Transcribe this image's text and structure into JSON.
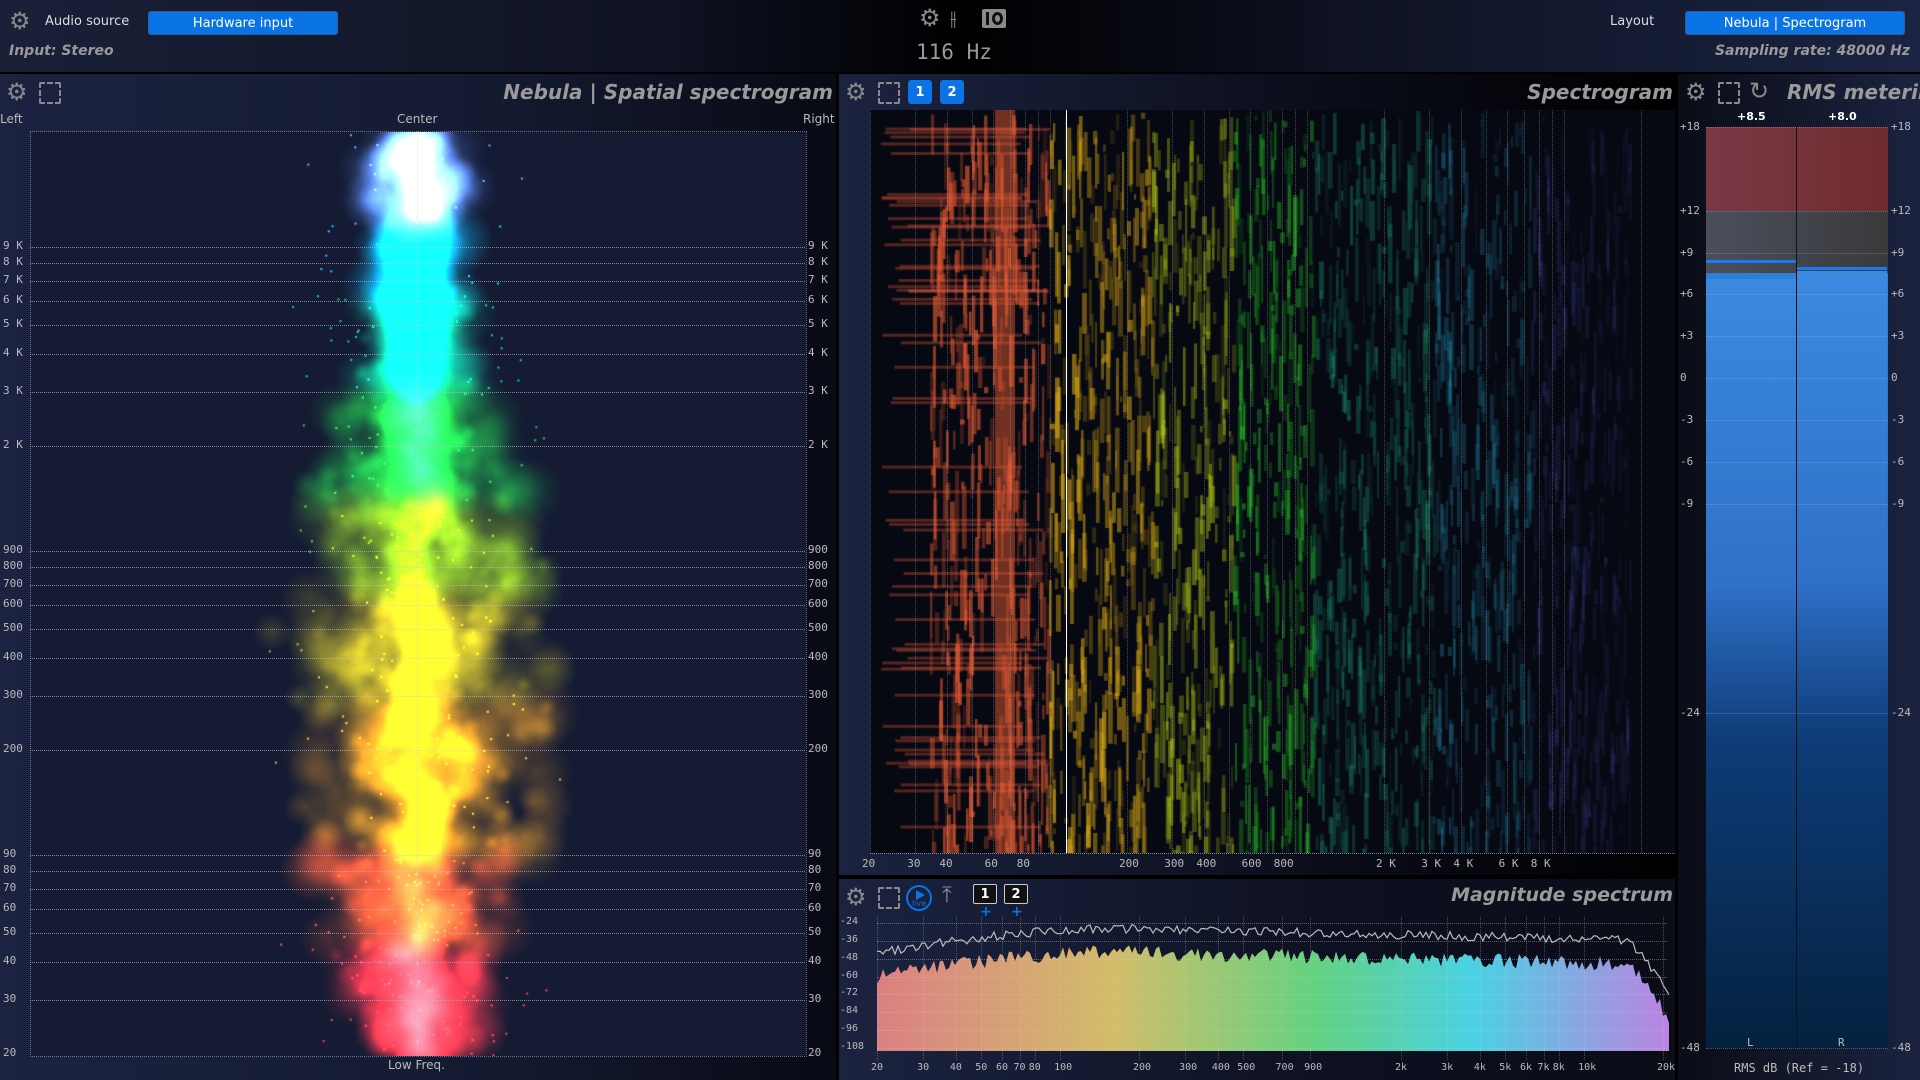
{
  "topbar": {
    "audio_source_label": "Audio source",
    "audio_source_value": "Hardware input",
    "input_status": "Input: Stereo",
    "frequency_readout": "116 Hz",
    "layout_label": "Layout",
    "layout_value": "Nebula | Spectrogram",
    "sampling_rate": "Sampling rate: 48000 Hz"
  },
  "spatial": {
    "title": "Nebula | Spatial spectrogram",
    "left_label": "Left",
    "center_label": "Center",
    "right_label": "Right",
    "bottom_label": "Low Freq.",
    "freq_ticks": [
      {
        "label": "9 K",
        "hz": 9000
      },
      {
        "label": "8 K",
        "hz": 8000
      },
      {
        "label": "7 K",
        "hz": 7000
      },
      {
        "label": "6 K",
        "hz": 6000
      },
      {
        "label": "5 K",
        "hz": 5000
      },
      {
        "label": "4 K",
        "hz": 4000
      },
      {
        "label": "3 K",
        "hz": 3000
      },
      {
        "label": "2 K",
        "hz": 2000
      },
      {
        "label": "900",
        "hz": 900
      },
      {
        "label": "800",
        "hz": 800
      },
      {
        "label": "700",
        "hz": 700
      },
      {
        "label": "600",
        "hz": 600
      },
      {
        "label": "500",
        "hz": 500
      },
      {
        "label": "400",
        "hz": 400
      },
      {
        "label": "300",
        "hz": 300
      },
      {
        "label": "200",
        "hz": 200
      },
      {
        "label": "90",
        "hz": 90
      },
      {
        "label": "80",
        "hz": 80
      },
      {
        "label": "70",
        "hz": 70
      },
      {
        "label": "60",
        "hz": 60
      },
      {
        "label": "50",
        "hz": 50
      },
      {
        "label": "40",
        "hz": 40
      },
      {
        "label": "30",
        "hz": 30
      },
      {
        "label": "20",
        "hz": 20
      }
    ]
  },
  "spectrogram": {
    "title": "Spectrogram",
    "channel_buttons": [
      "1",
      "2"
    ],
    "cursor_hz": 116,
    "freq_ticks": [
      {
        "label": "20",
        "hz": 20
      },
      {
        "label": "30",
        "hz": 30
      },
      {
        "label": "40",
        "hz": 40
      },
      {
        "label": "60",
        "hz": 60
      },
      {
        "label": "80",
        "hz": 80
      },
      {
        "label": "200",
        "hz": 200
      },
      {
        "label": "300",
        "hz": 300
      },
      {
        "label": "400",
        "hz": 400
      },
      {
        "label": "600",
        "hz": 600
      },
      {
        "label": "800",
        "hz": 800
      },
      {
        "label": "2 K",
        "hz": 2000
      },
      {
        "label": "3 K",
        "hz": 3000
      },
      {
        "label": "4 K",
        "hz": 4000
      },
      {
        "label": "6 K",
        "hz": 6000
      },
      {
        "label": "8 K",
        "hz": 8000
      }
    ]
  },
  "magnitude": {
    "title": "Magnitude spectrum",
    "live_label": "live",
    "slot_buttons": [
      "1",
      "2"
    ],
    "db_ticks": [
      -24,
      -36,
      -48,
      -60,
      -72,
      -84,
      -96,
      -108
    ],
    "freq_ticks": [
      {
        "label": "20",
        "hz": 20
      },
      {
        "label": "30",
        "hz": 30
      },
      {
        "label": "40",
        "hz": 40
      },
      {
        "label": "50",
        "hz": 50
      },
      {
        "label": "60",
        "hz": 60
      },
      {
        "label": "70",
        "hz": 70
      },
      {
        "label": "80",
        "hz": 80
      },
      {
        "label": "100",
        "hz": 100
      },
      {
        "label": "200",
        "hz": 200
      },
      {
        "label": "300",
        "hz": 300
      },
      {
        "label": "400",
        "hz": 400
      },
      {
        "label": "500",
        "hz": 500
      },
      {
        "label": "700",
        "hz": 700
      },
      {
        "label": "900",
        "hz": 900
      },
      {
        "label": "2k",
        "hz": 2000
      },
      {
        "label": "3k",
        "hz": 3000
      },
      {
        "label": "4k",
        "hz": 4000
      },
      {
        "label": "5k",
        "hz": 5000
      },
      {
        "label": "6k",
        "hz": 6000
      },
      {
        "label": "7k",
        "hz": 7000
      },
      {
        "label": "8k",
        "hz": 8000
      },
      {
        "label": "10k",
        "hz": 10000
      },
      {
        "label": "20k",
        "hz": 20000
      }
    ]
  },
  "rms": {
    "title": "RMS metering",
    "db_ticks": [
      "+18",
      "+12",
      "+9",
      "+6",
      "+3",
      "0",
      "-3",
      "-6",
      "-9",
      "-24",
      "-48"
    ],
    "channels": [
      {
        "name": "L",
        "peak_label": "+8.5",
        "peak_db": 8.5,
        "level_db": 7.1
      },
      {
        "name": "R",
        "peak_label": "+8.0",
        "peak_db": 8.0,
        "level_db": 7.7
      }
    ],
    "footer": "RMS dB (Ref = -18)"
  },
  "colors": {
    "accent": "#0a74e6",
    "panel": "#1b2340",
    "meter_blue": "#2f7fd6",
    "meter_red": "#743640"
  }
}
